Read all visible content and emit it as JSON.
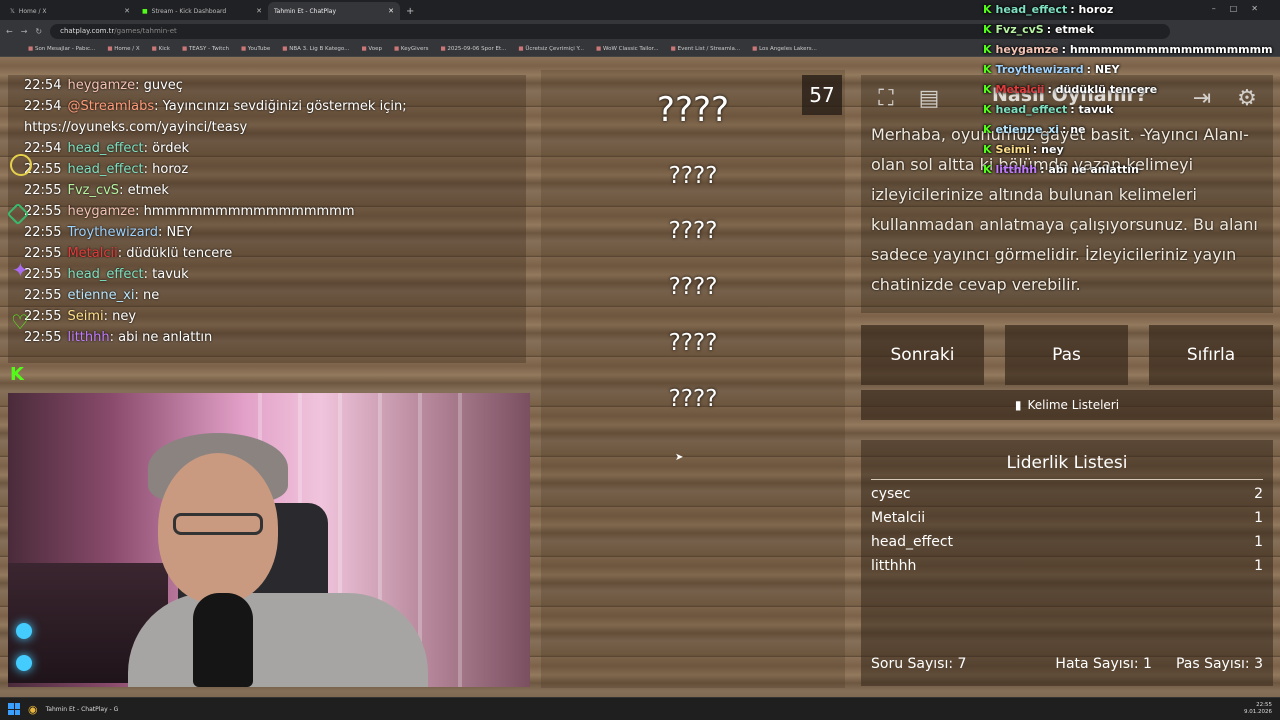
{
  "browser": {
    "tabs": [
      {
        "label": "Home / X"
      },
      {
        "label": "Stream - Kick Dashboard"
      },
      {
        "label": "Tahmin Et - ChatPlay"
      }
    ],
    "url_host": "chatplay.com.tr",
    "url_path": "/games/tahmin-et",
    "bookmarks": [
      "Son Mesajlar - Pabıc...",
      "Home / X",
      "Kick",
      "TEASY - Twitch",
      "YouTube",
      "NBA 3. Lig B Katego...",
      "Voep",
      "KeyGivers",
      "2025-09-06 Spor Et...",
      "Ücretsiz Çevrimiçi Y...",
      "WoW Classic Tailor...",
      "Event List / Streamla...",
      "Los Angeles Lakers..."
    ]
  },
  "chat": {
    "messages": [
      {
        "time": "22:54",
        "user": "heygamze",
        "color": "#f3c3b4",
        "text": "guveç"
      },
      {
        "time": "22:54",
        "user": "@Streamlabs",
        "color": "#ff9c7a",
        "text": "Yayıncınızı sevdiğinizi göstermek için;"
      },
      {
        "time": "",
        "user": "",
        "color": "#ffffff",
        "text": "https://oyuneks.com/yayinci/teasy"
      },
      {
        "time": "22:54",
        "user": "head_effect",
        "color": "#7ee1c2",
        "text": "ördek"
      },
      {
        "time": "22:55",
        "user": "head_effect",
        "color": "#7ee1c2",
        "text": "horoz"
      },
      {
        "time": "22:55",
        "user": "Fvz_cvS",
        "color": "#b7f3a2",
        "text": "etmek"
      },
      {
        "time": "22:55",
        "user": "heygamze",
        "color": "#f3c3b4",
        "text": "hmmmmmmmmmmmmmmmm"
      },
      {
        "time": "22:55",
        "user": "Troythewizard",
        "color": "#9fd3ff",
        "text": "NEY"
      },
      {
        "time": "22:55",
        "user": "Metalcii",
        "color": "#e23b3b",
        "text": "düdüklü tencere"
      },
      {
        "time": "22:55",
        "user": "head_effect",
        "color": "#7ee1c2",
        "text": "tavuk"
      },
      {
        "time": "22:55",
        "user": "etienne_xi",
        "color": "#b8e7ff",
        "text": "ne"
      },
      {
        "time": "22:55",
        "user": "Seimi",
        "color": "#ffe08a",
        "text": "ney"
      },
      {
        "time": "22:55",
        "user": "litthhh",
        "color": "#c07bff",
        "text": "abi ne anlattın"
      }
    ]
  },
  "game": {
    "counter": "57",
    "words": [
      "????",
      "????",
      "????",
      "????",
      "????",
      "????"
    ],
    "howto_title": "Nasıl Oynanır?",
    "howto_text": "Merhaba, oyunumuz gayet basit. -Yayıncı Alanı- olan sol altta ki bölümde yazan kelimeyi izleyicilerinize altında bulunan kelimeleri kullanmadan anlatmaya çalışıyorsunuz. Bu alanı sadece yayıncı görmelidir. İzleyicileriniz yayın chatinizde cevap verebilir.",
    "buttons": {
      "next": "Sonraki",
      "pass": "Pas",
      "reset": "Sıfırla"
    },
    "word_lists": "Kelime Listeleri",
    "leaderboard": {
      "title": "Liderlik Listesi",
      "rows": [
        {
          "name": "cysec",
          "score": "2"
        },
        {
          "name": "Metalcii",
          "score": "1"
        },
        {
          "name": "head_effect",
          "score": "1"
        },
        {
          "name": "litthhh",
          "score": "1"
        }
      ]
    },
    "stats": {
      "questions": "Soru Sayısı: 7",
      "errors": "Hata Sayısı: 1",
      "passes": "Pas Sayısı: 3"
    }
  },
  "overlay": {
    "messages": [
      {
        "user": "head_effect",
        "color": "#7ee1c2",
        "text": ": horoz"
      },
      {
        "user": "Fvz_cvS",
        "color": "#b7f3a2",
        "text": ": etmek"
      },
      {
        "user": "heygamze",
        "color": "#f3c3b4",
        "text": ": hmmmmmmmmmmmmmmmmm"
      },
      {
        "user": "Troythewizard",
        "color": "#9fd3ff",
        "text": ": NEY"
      },
      {
        "user": "Metalcii",
        "color": "#e23b3b",
        "text": ": düdüklü tencere"
      },
      {
        "user": "head_effect",
        "color": "#7ee1c2",
        "text": ": tavuk"
      },
      {
        "user": "etienne_xi",
        "color": "#b8e7ff",
        "text": ": ne"
      },
      {
        "user": "Seimi",
        "color": "#ffe08a",
        "text": ": ney"
      },
      {
        "user": "litthhh",
        "color": "#c07bff",
        "text": ": abi ne anlattın"
      }
    ]
  },
  "taskbar": {
    "app_label": "Tahmin Et - ChatPlay - G",
    "time": "22:55",
    "date": "9.01.2026"
  }
}
